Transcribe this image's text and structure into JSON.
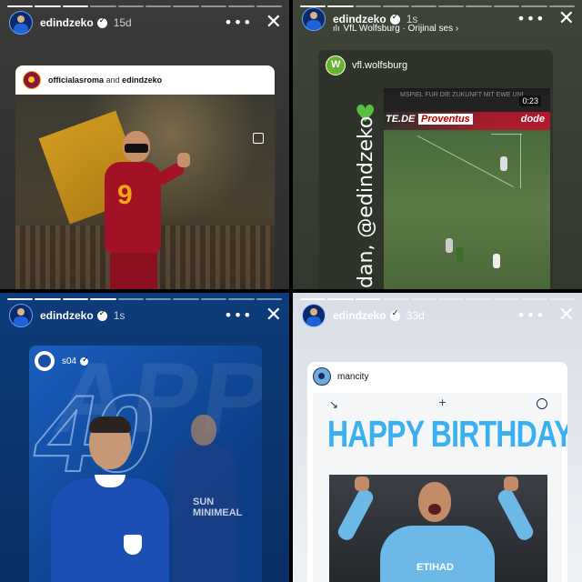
{
  "stories": [
    {
      "username": "edindzeko",
      "time": "15d",
      "more_label": "•••",
      "close_label": "✕",
      "card": {
        "owner": "officialasroma",
        "joiner": "and",
        "collaborator": "edindzeko",
        "jersey_number": "9"
      }
    },
    {
      "username": "edindzeko",
      "time": "1s",
      "subline": "VfL Wolfsburg · Orijinal ses",
      "subline_chevron": "›",
      "more_label": "•••",
      "close_label": "✕",
      "card": {
        "owner": "vfl.wolfsburg",
        "video_time": "0:23",
        "banner_text": "MSPIEL FÜR DIE ZUKUNFT MIT EWE UND SWI",
        "ad_left": "TE.DE",
        "ad_mid": "Proventus",
        "ad_right": "dode",
        "vertical_text": "dan, @edindzeko",
        "heart": "♥"
      }
    },
    {
      "username": "edindzeko",
      "time": "1s",
      "more_label": "•••",
      "close_label": "✕",
      "card": {
        "owner": "s04",
        "bg_text": "APPY",
        "big_number": "40",
        "sponsor": "SUN MINIMEAL"
      }
    },
    {
      "username": "edindzeko",
      "time": "33d",
      "more_label": "•••",
      "close_label": "✕",
      "card": {
        "owner": "mancity",
        "headline": "HAPPY BIRTHDAY",
        "arrow": "↘",
        "plus": "+",
        "sponsor": "ETIHAD"
      }
    }
  ],
  "colors": {
    "roma_red": "#a31224",
    "wolfsburg_green": "#65b32e",
    "schalke_blue": "#1b4fa3",
    "city_sky": "#3ab0f0"
  }
}
